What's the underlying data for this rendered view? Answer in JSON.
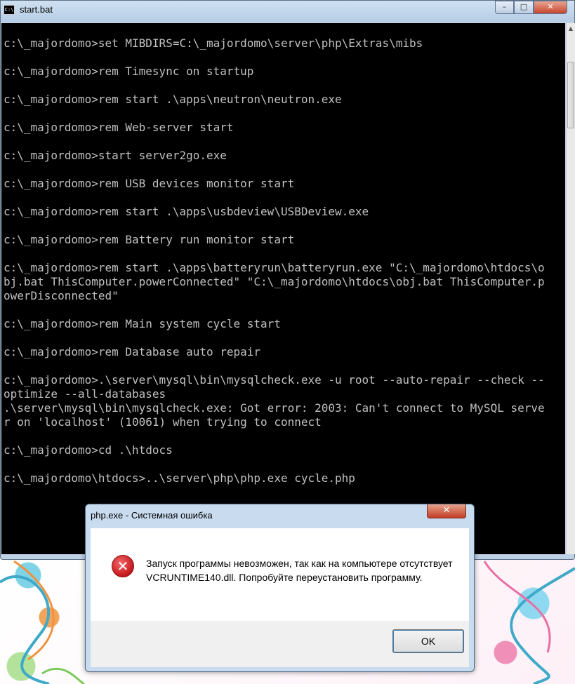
{
  "console": {
    "title": "start.bat",
    "icon": "C:\\",
    "lines": [
      "c:\\_majordomo>set MIBDIRS=C:\\_majordomo\\server\\php\\Extras\\mibs",
      "",
      "c:\\_majordomo>rem Timesync on startup",
      "",
      "c:\\_majordomo>rem start .\\apps\\neutron\\neutron.exe",
      "",
      "c:\\_majordomo>rem Web-server start",
      "",
      "c:\\_majordomo>start server2go.exe",
      "",
      "c:\\_majordomo>rem USB devices monitor start",
      "",
      "c:\\_majordomo>rem start .\\apps\\usbdeview\\USBDeview.exe",
      "",
      "c:\\_majordomo>rem Battery run monitor start",
      "",
      "c:\\_majordomo>rem start .\\apps\\batteryrun\\batteryrun.exe \"C:\\_majordomo\\htdocs\\o",
      "bj.bat ThisComputer.powerConnected\" \"C:\\_majordomo\\htdocs\\obj.bat ThisComputer.p",
      "owerDisconnected\"",
      "",
      "c:\\_majordomo>rem Main system cycle start",
      "",
      "c:\\_majordomo>rem Database auto repair",
      "",
      "c:\\_majordomo>.\\server\\mysql\\bin\\mysqlcheck.exe -u root --auto-repair --check --",
      "optimize --all-databases",
      ".\\server\\mysql\\bin\\mysqlcheck.exe: Got error: 2003: Can't connect to MySQL serve",
      "r on 'localhost' (10061) when trying to connect",
      "",
      "c:\\_majordomo>cd .\\htdocs",
      "",
      "c:\\_majordomo\\htdocs>..\\server\\php\\php.exe cycle.php"
    ],
    "buttons": {
      "minimize": "–",
      "maximize": "□",
      "close": "✕"
    }
  },
  "dialog": {
    "title": "php.exe - Системная ошибка",
    "close": "✕",
    "icon": "error-icon",
    "icon_glyph": "✕",
    "message": "Запуск программы невозможен, так как на компьютере отсутствует VCRUNTIME140.dll. Попробуйте переустановить программу.",
    "ok_label": "OK"
  },
  "colors": {
    "console_bg": "#000000",
    "console_text": "#c0c0c0",
    "frame": "#bfd2e6",
    "close_red": "#c7452e",
    "error_red": "#c4161c"
  }
}
